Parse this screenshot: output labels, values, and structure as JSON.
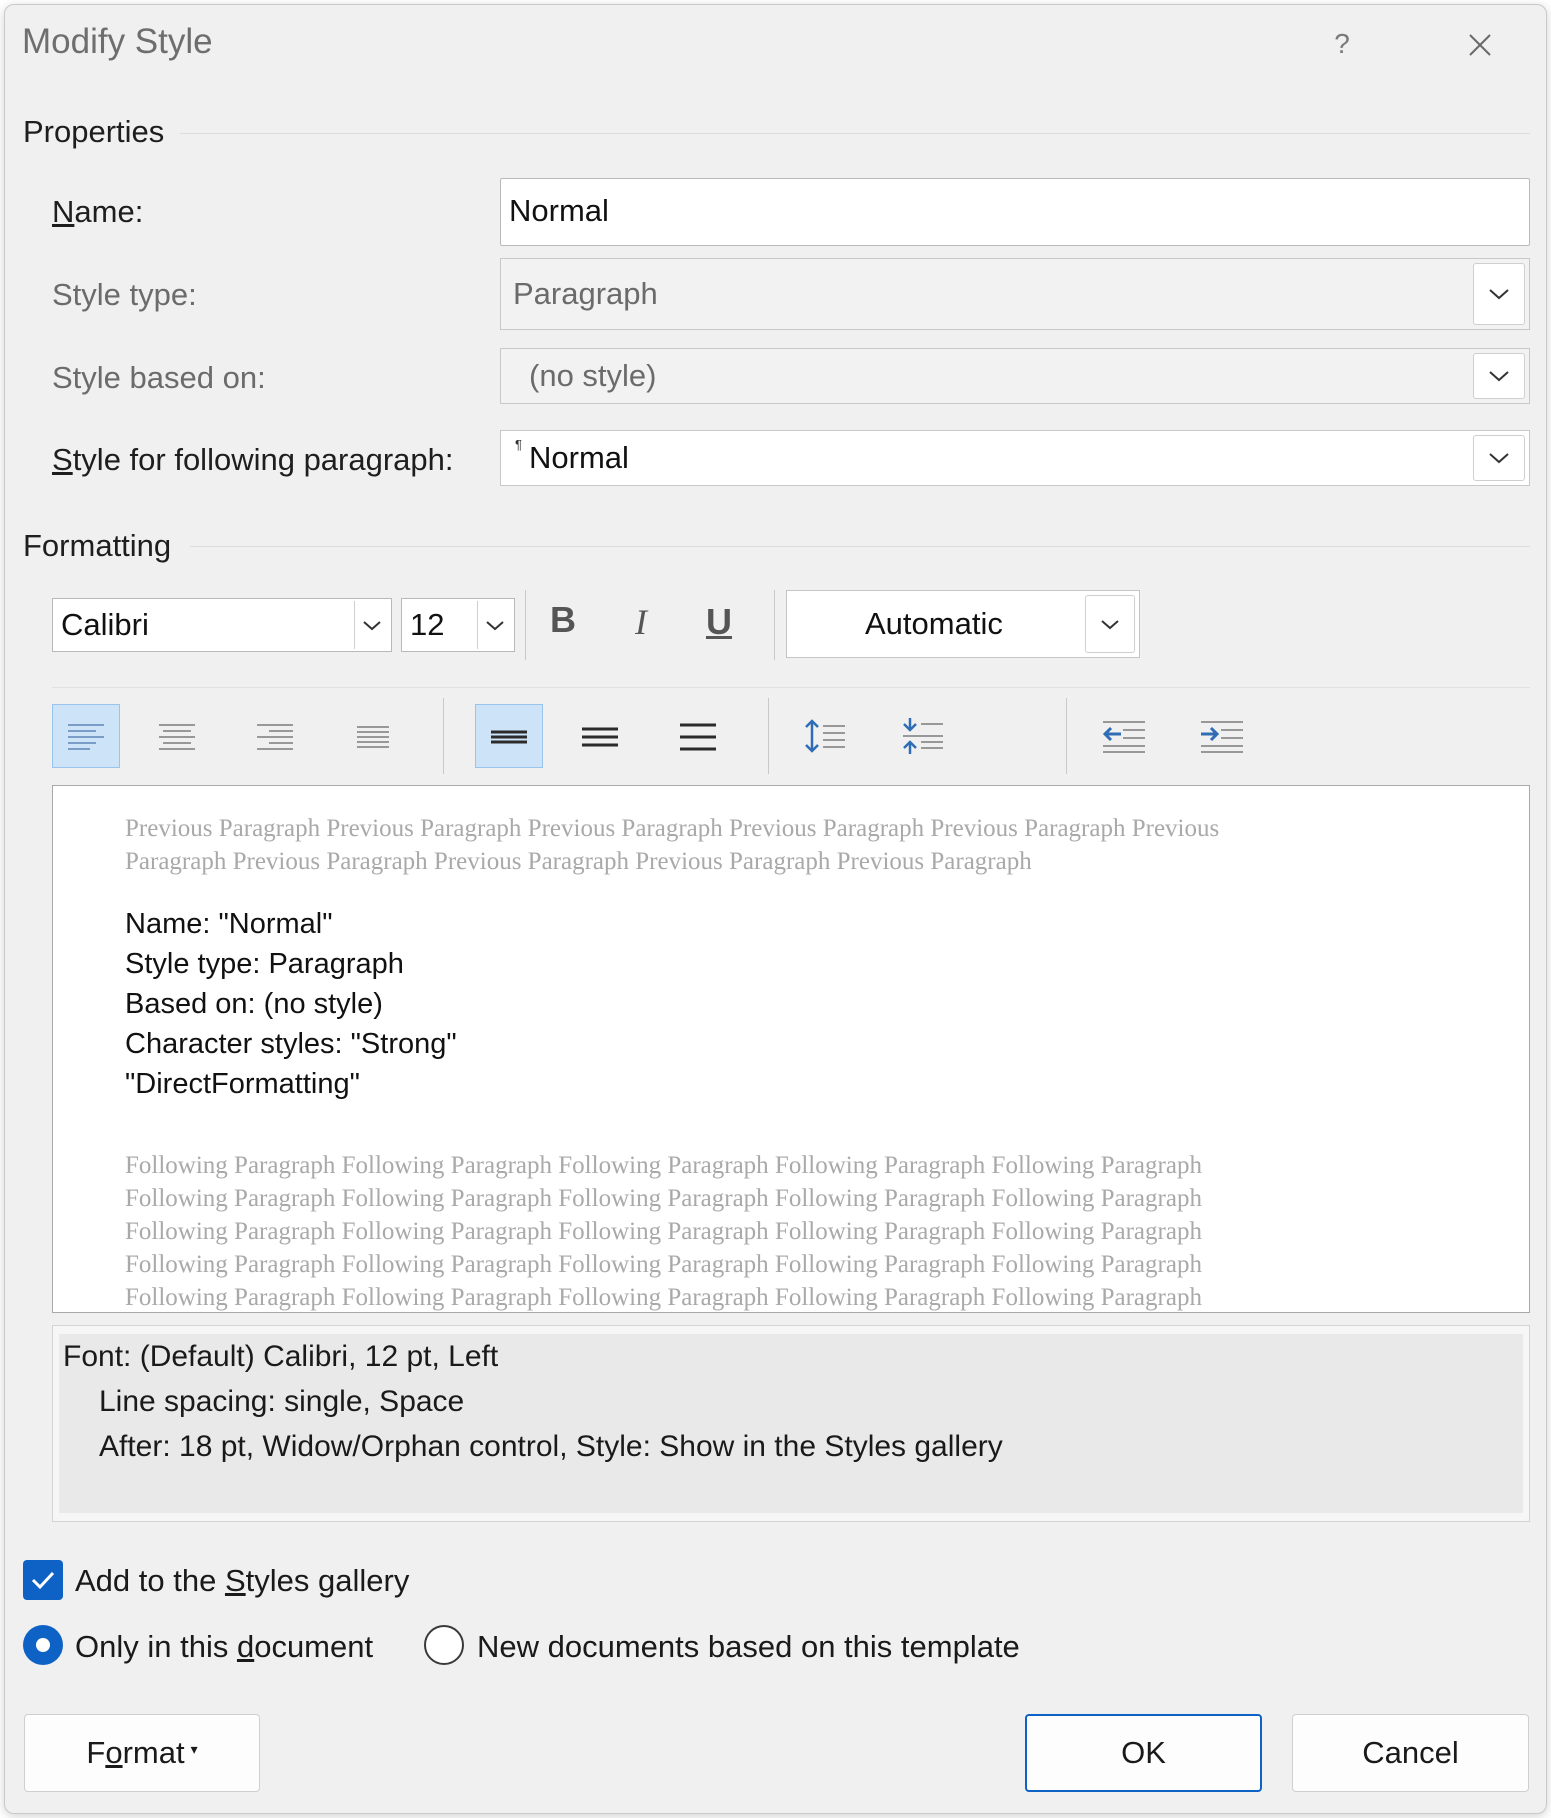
{
  "dialog": {
    "title": "Modify Style",
    "help": "?"
  },
  "properties": {
    "group_label": "Properties",
    "name_label": {
      "pre": "",
      "key": "N",
      "post": "ame:"
    },
    "name_value": "Normal",
    "style_type_label": "Style type:",
    "style_type_value": "Paragraph",
    "based_on_label": "Style based on:",
    "based_on_value": "(no style)",
    "following_label": {
      "pre": "",
      "key": "S",
      "post": "tyle for following paragraph:"
    },
    "following_mark": "¶",
    "following_value": "Normal"
  },
  "formatting": {
    "group_label": "Formatting",
    "font_name": "Calibri",
    "font_size": "12",
    "bold": "B",
    "italic": "I",
    "underline": "U",
    "color_value": "Automatic",
    "toolbar_icons": [
      "align-left-icon",
      "align-center-icon",
      "align-right-icon",
      "justify-icon",
      "single-spacing-icon",
      "one-half-spacing-icon",
      "double-spacing-icon",
      "increase-paragraph-spacing-icon",
      "decrease-paragraph-spacing-icon",
      "decrease-indent-icon",
      "increase-indent-icon"
    ],
    "active_alignment": "align-left",
    "active_spacing": "single"
  },
  "preview": {
    "previous_lines": [
      "Previous Paragraph Previous Paragraph Previous Paragraph Previous Paragraph Previous Paragraph Previous",
      "Paragraph Previous Paragraph Previous Paragraph Previous Paragraph Previous Paragraph"
    ],
    "sample_lines": [
      "Name: \"Normal\"",
      "Style type: Paragraph",
      "Based on: (no style)",
      "Character styles: \"Strong\"",
      "\"DirectFormatting\""
    ],
    "following_lines": [
      "Following Paragraph Following Paragraph Following Paragraph Following Paragraph Following Paragraph",
      "Following Paragraph Following Paragraph Following Paragraph Following Paragraph Following Paragraph",
      "Following Paragraph Following Paragraph Following Paragraph Following Paragraph Following Paragraph",
      "Following Paragraph Following Paragraph Following Paragraph Following Paragraph Following Paragraph",
      "Following Paragraph Following Paragraph Following Paragraph Following Paragraph Following Paragraph"
    ]
  },
  "description": {
    "line1": "Font: (Default) Calibri, 12 pt, Left",
    "line2": "Line spacing:  single, Space",
    "line3": "After:  18 pt, Widow/Orphan control, Style: Show in the Styles gallery"
  },
  "options": {
    "add_gallery": {
      "pre": "Add to the ",
      "key": "S",
      "post": "tyles gallery",
      "checked": true
    },
    "only_doc": {
      "pre": "Only in this ",
      "key": "d",
      "post": "ocument",
      "selected": true
    },
    "new_docs": {
      "text": "New documents based on this template",
      "selected": false
    }
  },
  "buttons": {
    "format": {
      "pre": "F",
      "key": "o",
      "post": "rmat",
      "arrow": "▾"
    },
    "ok": "OK",
    "cancel": "Cancel"
  },
  "colors": {
    "accent": "#0f62c5",
    "toolbar_icon_blue": "#2f6db5",
    "active_tool_bg": "#cde3f7",
    "preview_gray_text": "#a9a9a9"
  }
}
